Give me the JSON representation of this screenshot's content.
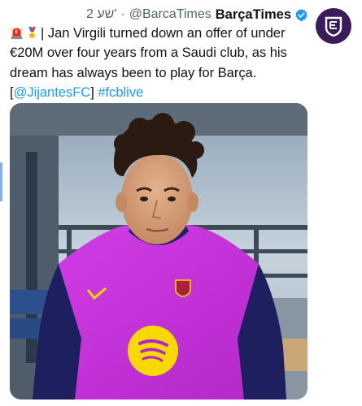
{
  "tweet": {
    "time": "2 שע'",
    "handle": "@BarcaTimes",
    "display_name": "BarçaTimes",
    "verified": true,
    "text_main": "| Jan Virgili turned down an offer of under €20M over four years from a Saudi club, as his dream has always been to play for Barça. [",
    "mention": "@JijantesFC",
    "text_close": "] ",
    "hashtag": "#fcblive"
  },
  "avatar": {
    "icon": "barca-times-logo-icon",
    "background": "#3a1c5a"
  },
  "photo": {
    "subject": "player-photo",
    "shirt_color": "#c531d8",
    "sleeve_color": "#1d1f5e",
    "sponsor_color": "#f7d800"
  },
  "colors": {
    "link": "#1d9bf0",
    "text": "#0f1419",
    "muted": "#536471",
    "verified": "#1d9bf0"
  }
}
